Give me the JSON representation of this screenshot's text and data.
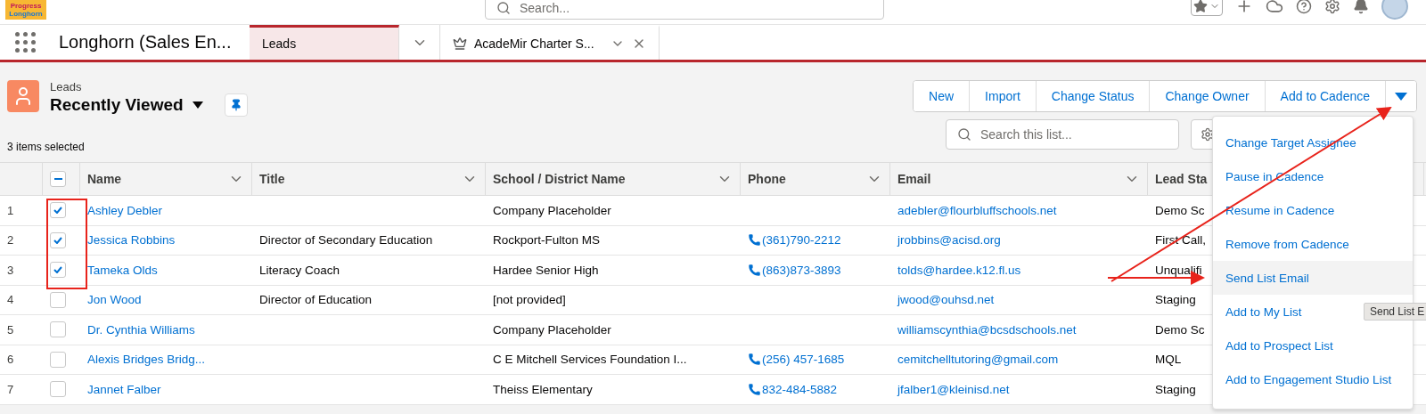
{
  "header": {
    "logo_lines": [
      "Progress",
      "Longhorn"
    ],
    "search": {
      "placeholder": "Search..."
    }
  },
  "nav": {
    "app_name": "Longhorn (Sales En...",
    "tabs": [
      {
        "label": "Leads",
        "kind": "object",
        "selected": true
      },
      {
        "label": "AcadeMir Charter S...",
        "kind": "record",
        "selected": false
      }
    ]
  },
  "list_header": {
    "object": "Leads",
    "view": "Recently Viewed",
    "selection": "3 items selected",
    "buttons": [
      "New",
      "Import",
      "Change Status",
      "Change Owner",
      "Add to Cadence"
    ],
    "search": {
      "placeholder": "Search this list..."
    }
  },
  "table": {
    "header_checkbox": {
      "indeterminate": true
    },
    "columns": [
      "Name",
      "Title",
      "School / District Name",
      "Phone",
      "Email",
      "Lead Sta"
    ],
    "rows": [
      {
        "number": "1",
        "checked": true,
        "name": "Ashley Debler",
        "title": "",
        "school": "Company Placeholder",
        "phone": "",
        "email": "adebler@flourbluffschools.net",
        "lead_status": "Demo Sc"
      },
      {
        "number": "2",
        "checked": true,
        "name": "Jessica Robbins",
        "title": "Director of Secondary Education",
        "school": "Rockport-Fulton MS",
        "phone": "(361)790-2212",
        "email": "jrobbins@acisd.org",
        "lead_status": "First Call,"
      },
      {
        "number": "3",
        "checked": true,
        "name": "Tameka Olds",
        "title": "Literacy Coach",
        "school": "Hardee Senior High",
        "phone": "(863)873-3893",
        "email": "tolds@hardee.k12.fl.us",
        "lead_status": "Unqualifi"
      },
      {
        "number": "4",
        "checked": false,
        "name": "Jon Wood",
        "title": "Director of Education",
        "school": "[not provided]",
        "phone": "",
        "email": "jwood@ouhsd.net",
        "lead_status": "Staging"
      },
      {
        "number": "5",
        "checked": false,
        "name": "Dr. Cynthia Williams",
        "title": "",
        "school": "Company Placeholder",
        "phone": "",
        "email": "williamscynthia@bcsdschools.net",
        "lead_status": "Demo Sc"
      },
      {
        "number": "6",
        "checked": false,
        "name": "Alexis Bridges Bridg...",
        "title": "",
        "school": "C E Mitchell Services Foundation I...",
        "phone": "(256) 457-1685",
        "email": "cemitchelltutoring@gmail.com",
        "lead_status": "MQL"
      },
      {
        "number": "7",
        "checked": false,
        "name": "Jannet Falber",
        "title": "",
        "school": "Theiss Elementary",
        "phone": "832-484-5882",
        "email": "jfalber1@kleinisd.net",
        "lead_status": "Staging"
      }
    ]
  },
  "menu": {
    "items": [
      {
        "label": "Change Target Assignee",
        "selected": false
      },
      {
        "label": "Pause in Cadence",
        "selected": false
      },
      {
        "label": "Resume in Cadence",
        "selected": false
      },
      {
        "label": "Remove from Cadence",
        "selected": false
      },
      {
        "label": "Send List Email",
        "selected": true
      },
      {
        "label": "Add to My List",
        "selected": false
      },
      {
        "label": "Add to Prospect List",
        "selected": false
      },
      {
        "label": "Add to Engagement Studio List",
        "selected": false
      }
    ]
  },
  "tooltip": "Send List E"
}
